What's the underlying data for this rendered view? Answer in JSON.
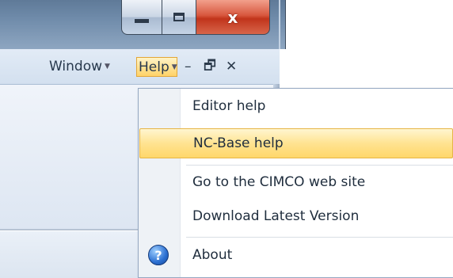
{
  "window_controls": {
    "minimize_icon": "minimize-icon",
    "maximize_icon": "maximize-icon",
    "close_icon": "close-icon",
    "close_glyph": "x"
  },
  "menubar": {
    "window_label": "Window",
    "help_label": "Help",
    "dropdown_glyph": "▼",
    "mdi_min": "–",
    "mdi_restore": "🗗",
    "mdi_close": "✕"
  },
  "help_menu": {
    "items": [
      {
        "label": "Editor help"
      },
      {
        "label": "NC-Base help",
        "highlighted": true
      },
      {
        "label": "Go to the CIMCO web site"
      },
      {
        "label": "Download Latest Version"
      },
      {
        "label": "About",
        "icon": "help-question-icon"
      }
    ]
  },
  "colors": {
    "highlight": "#ffe391",
    "highlight_border": "#e6b547",
    "close_button": "#d8573e"
  }
}
